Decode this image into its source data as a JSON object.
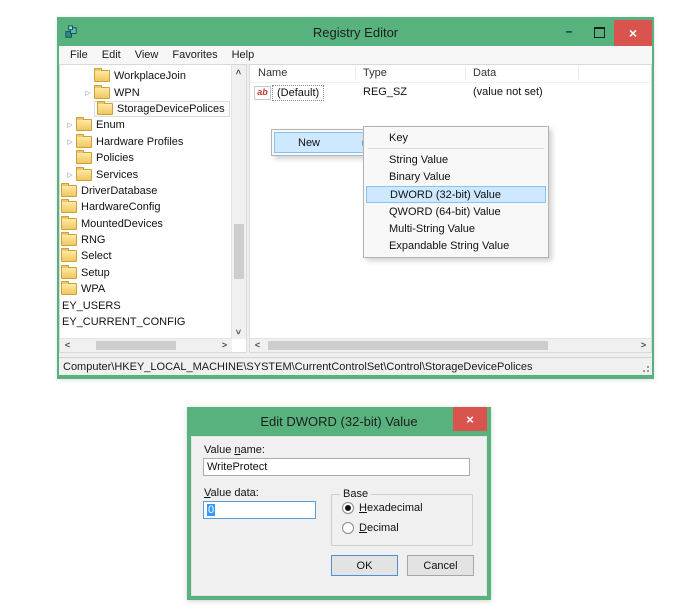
{
  "colors": {
    "titlebar_green": "#58b27d",
    "close_red": "#d9534f",
    "menu_highlight_bg": "#cde8ff",
    "menu_highlight_border": "#86c3ee",
    "selection_blue": "#3399ff"
  },
  "icons": {
    "expander_collapsed": "▷",
    "submenu_arrow": "▶",
    "close_x": "×",
    "minimize": "–",
    "chevron_left": "<",
    "chevron_right": ">"
  },
  "registry_window": {
    "title": "Registry Editor",
    "menubar": [
      "File",
      "Edit",
      "View",
      "Favorites",
      "Help"
    ],
    "tree": {
      "items": [
        {
          "label": "WorkplaceJoin",
          "level": 2,
          "expandable": false
        },
        {
          "label": "WPN",
          "level": 2,
          "expandable": true
        },
        {
          "label": "StorageDevicePolices",
          "level": 2,
          "expandable": false,
          "selected": true
        },
        {
          "label": "Enum",
          "level": 1,
          "expandable": true
        },
        {
          "label": "Hardware Profiles",
          "level": 1,
          "expandable": true
        },
        {
          "label": "Policies",
          "level": 1,
          "expandable": false
        },
        {
          "label": "Services",
          "level": 1,
          "expandable": true
        },
        {
          "label": "DriverDatabase",
          "level": 0,
          "expandable": false
        },
        {
          "label": "HardwareConfig",
          "level": 0,
          "expandable": false
        },
        {
          "label": "MountedDevices",
          "level": 0,
          "expandable": false
        },
        {
          "label": "RNG",
          "level": 0,
          "expandable": false
        },
        {
          "label": "Select",
          "level": 0,
          "expandable": false
        },
        {
          "label": "Setup",
          "level": 0,
          "expandable": false
        },
        {
          "label": "WPA",
          "level": 0,
          "expandable": false
        },
        {
          "label": "EY_USERS",
          "level": -1,
          "expandable": false
        },
        {
          "label": "EY_CURRENT_CONFIG",
          "level": -1,
          "expandable": false
        }
      ]
    },
    "list": {
      "columns": [
        "Name",
        "Type",
        "Data"
      ],
      "rows": [
        {
          "icon": "ab",
          "name": "(Default)",
          "type": "REG_SZ",
          "data": "(value not set)"
        }
      ]
    },
    "statusbar": {
      "path": "Computer\\HKEY_LOCAL_MACHINE\\SYSTEM\\CurrentControlSet\\Control\\StorageDevicePolices"
    }
  },
  "context_menu": {
    "new_label": "New"
  },
  "submenu": {
    "items": [
      "Key",
      "String Value",
      "Binary Value",
      "DWORD (32-bit) Value",
      "QWORD (64-bit) Value",
      "Multi-String Value",
      "Expandable String Value"
    ],
    "highlighted": "DWORD (32-bit) Value"
  },
  "dialog": {
    "title": "Edit DWORD (32-bit) Value",
    "value_name_label": {
      "pre": "Value ",
      "key": "n",
      "post": "ame:"
    },
    "value_name": "WriteProtect",
    "value_data_label": {
      "pre": "",
      "key": "V",
      "post": "alue data:"
    },
    "value_data": "0",
    "base_group_label": "Base",
    "hexadecimal_label": {
      "pre": "",
      "key": "H",
      "post": "exadecimal"
    },
    "decimal_label": {
      "pre": "",
      "key": "D",
      "post": "ecimal"
    },
    "selected_base": "Hexadecimal",
    "ok_label": "OK",
    "cancel_label": "Cancel"
  }
}
